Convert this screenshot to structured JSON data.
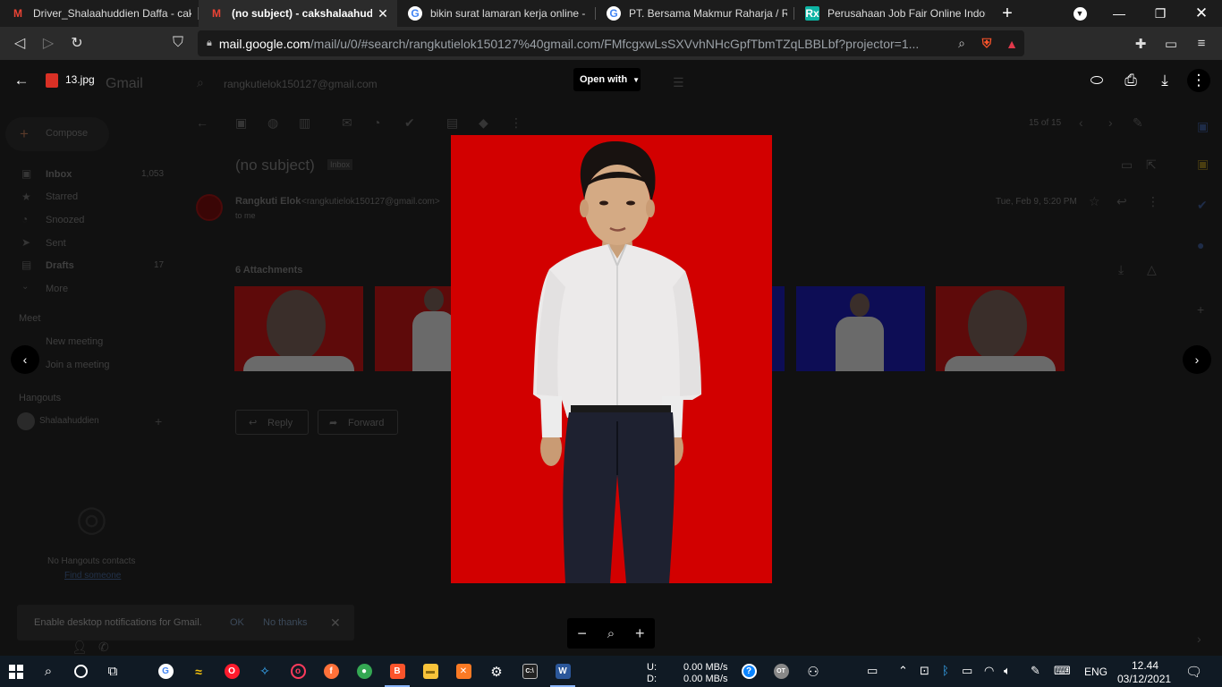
{
  "browser": {
    "tabs": [
      {
        "title": "Driver_Shalaahuddien Daffa - caksh",
        "favicon": "gmail-icon",
        "active": false
      },
      {
        "title": "(no subject) - cakshalaahuddie",
        "favicon": "gmail-icon",
        "active": true
      },
      {
        "title": "bikin surat lamaran kerja online - P",
        "favicon": "google-icon",
        "active": false
      },
      {
        "title": "PT. Bersama Makmur Raharja / Rah",
        "favicon": "google-icon",
        "active": false
      },
      {
        "title": "Perusahaan Job Fair Online Indone",
        "favicon": "rx-icon",
        "active": false
      }
    ],
    "url_host": "mail.google.com",
    "url_rest": "/mail/u/0/#search/rangkutielok150127%40gmail.com/FMfcgxwLsSXVvhNHcGpfTbmTZqLBBLbf?projector=1..."
  },
  "viewer": {
    "file_name": "13.jpg",
    "open_with_label": "Open with"
  },
  "gmail": {
    "logo": "Gmail",
    "search_value": "rangkutielok150127@gmail.com",
    "compose": "Compose",
    "nav": [
      {
        "label": "Inbox",
        "count": "1,053",
        "icon": "inbox-icon"
      },
      {
        "label": "Starred",
        "count": "",
        "icon": "star-icon"
      },
      {
        "label": "Snoozed",
        "count": "",
        "icon": "clock-icon"
      },
      {
        "label": "Sent",
        "count": "",
        "icon": "send-icon"
      },
      {
        "label": "Drafts",
        "count": "17",
        "icon": "draft-icon"
      },
      {
        "label": "More",
        "count": "",
        "icon": "chevron-down-icon"
      }
    ],
    "meet_heading": "Meet",
    "meet_items": [
      "New meeting",
      "Join a meeting"
    ],
    "hangouts_heading": "Hangouts",
    "hangouts_user": "Shalaahuddien",
    "no_contacts": "No Hangouts contacts",
    "find_someone": "Find someone",
    "pager": "15 of 15",
    "subject": "(no subject)",
    "label_chip": "Inbox",
    "sender_name": "Rangkuti Elok",
    "sender_email": "<rangkutielok150127@gmail.com>",
    "to_me": "to me",
    "date": "Tue, Feb 9, 5:20 PM",
    "attachments_label": "6 Attachments",
    "reply": "Reply",
    "forward": "Forward"
  },
  "toast": {
    "message": "Enable desktop notifications for Gmail.",
    "ok": "OK",
    "no_thanks": "No thanks"
  },
  "taskbar": {
    "net_up_label": "U:",
    "net_down_label": "D:",
    "net_up": "0.00 MB/s",
    "net_down": "0.00 MB/s",
    "lang": "ENG",
    "time": "12.44",
    "date": "03/12/2021"
  },
  "colors": {
    "photo_background": "#d00000",
    "accent": "#8ab4f8"
  }
}
